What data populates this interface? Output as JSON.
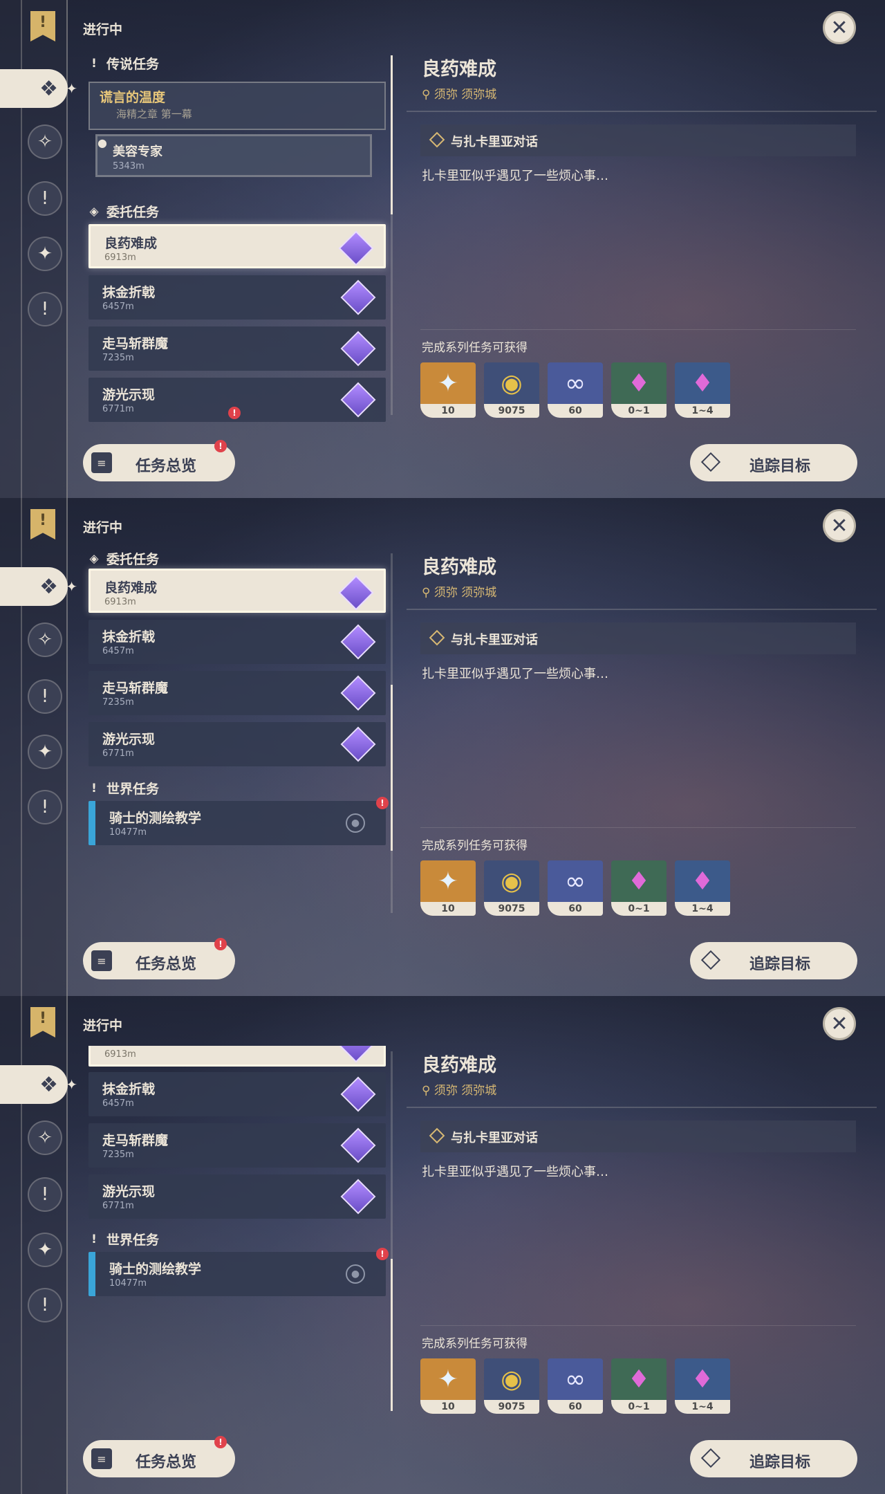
{
  "header": {
    "in_progress": "进行中"
  },
  "icons": {
    "close": "✕",
    "rail_flag": "!",
    "spark": "✦"
  },
  "sections": {
    "legend": "传说任务",
    "commission": "委托任务",
    "world": "世界任务"
  },
  "legend_quest": {
    "name": "谎言的温度",
    "chapter": "海精之章 第一幕",
    "sub_name": "美容专家",
    "sub_distance": "5343m"
  },
  "quests": [
    {
      "name": "良药难成",
      "distance": "6913m"
    },
    {
      "name": "抹金折戟",
      "distance": "6457m"
    },
    {
      "name": "走马斩群魔",
      "distance": "7235m"
    },
    {
      "name": "游光示现",
      "distance": "6771m"
    }
  ],
  "world_quest": {
    "name": "骑士的测绘教学",
    "distance": "10477m"
  },
  "detail": {
    "title": "良药难成",
    "location": "须弥 须弥城",
    "objective": "与扎卡里亚对话",
    "description": "扎卡里亚似乎遇见了一些烦心事…",
    "reward_heading": "完成系列任务可获得"
  },
  "rewards": [
    {
      "name": "primogem",
      "amount": "10",
      "color": "#c98a3a",
      "glyph": "✦"
    },
    {
      "name": "mora",
      "amount": "9075",
      "color": "#3f4f78",
      "glyph": "◉"
    },
    {
      "name": "adventure-exp",
      "amount": "60",
      "color": "#4a5a9a",
      "glyph": "∞"
    },
    {
      "name": "crystal",
      "amount": "0~1",
      "color": "#3f6a55",
      "glyph": "♦"
    },
    {
      "name": "crystal-cluster",
      "amount": "1~4",
      "color": "#3c5a8a",
      "glyph": "♦"
    }
  ],
  "buttons": {
    "overview": "任务总览",
    "track": "追踪目标"
  },
  "notice_mark": "!"
}
